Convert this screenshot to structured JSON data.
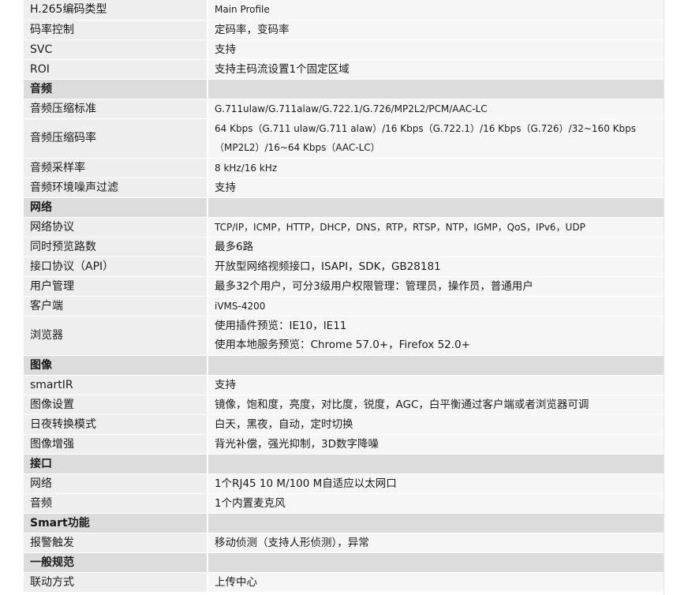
{
  "rows": [
    {
      "type": "row",
      "label": "H.265编码类型",
      "value": "Main Profile",
      "small": true
    },
    {
      "type": "row",
      "label": "码率控制",
      "value": "定码率，变码率"
    },
    {
      "type": "row",
      "label": "SVC",
      "value": "支持"
    },
    {
      "type": "row",
      "label": "ROI",
      "value": "支持主码流设置1个固定区域"
    },
    {
      "type": "section",
      "label": "音频"
    },
    {
      "type": "row",
      "label": "音频压缩标准",
      "value": "G.711ulaw/G.711alaw/G.722.1/G.726/MP2L2/PCM/AAC-LC",
      "small": true
    },
    {
      "type": "row",
      "label": "音频压缩码率",
      "lines": [
        "64 Kbps（G.711 ulaw/G.711 alaw）/16 Kbps（G.722.1）/16 Kbps（G.726）/32~160 Kbps",
        "（MP2L2）/16~64 Kbps（AAC-LC）"
      ],
      "small": true
    },
    {
      "type": "row",
      "label": "音频采样率",
      "value": "8 kHz/16 kHz",
      "small": true
    },
    {
      "type": "row",
      "label": "音频环境噪声过滤",
      "value": "支持"
    },
    {
      "type": "section",
      "label": "网络"
    },
    {
      "type": "row",
      "label": "网络协议",
      "value": "TCP/IP，ICMP，HTTP，DHCP，DNS，RTP，RTSP，NTP，IGMP，QoS，IPv6，UDP",
      "small": true
    },
    {
      "type": "row",
      "label": "同时预览路数",
      "value": "最多6路"
    },
    {
      "type": "row",
      "label": "接口协议（API）",
      "value": "开放型网络视频接口，ISAPI，SDK，GB28181"
    },
    {
      "type": "row",
      "label": "用户管理",
      "value": "最多32个用户，可分3级用户权限管理：管理员，操作员，普通用户"
    },
    {
      "type": "row",
      "label": "客户端",
      "value": "iVMS-4200",
      "small": true
    },
    {
      "type": "row",
      "label": "浏览器",
      "lines": [
        "使用插件预览：IE10，IE11",
        "使用本地服务预览：Chrome 57.0+，Firefox 52.0+"
      ]
    },
    {
      "type": "section",
      "label": "图像"
    },
    {
      "type": "row",
      "label": "smartIR",
      "value": "支持"
    },
    {
      "type": "row",
      "label": "图像设置",
      "value": "镜像，饱和度，亮度，对比度，锐度，AGC，白平衡通过客户端或者浏览器可调"
    },
    {
      "type": "row",
      "label": "日夜转换模式",
      "value": "白天，黑夜，自动，定时切换"
    },
    {
      "type": "row",
      "label": "图像增强",
      "value": "背光补偿，强光抑制，3D数字降噪"
    },
    {
      "type": "section",
      "label": "接口"
    },
    {
      "type": "row",
      "label": "网络",
      "value": "1个RJ45 10 M/100 M自适应以太网口"
    },
    {
      "type": "row",
      "label": "音频",
      "value": "1个内置麦克风"
    },
    {
      "type": "section",
      "label": "Smart功能"
    },
    {
      "type": "row",
      "label": "报警触发",
      "value": "移动侦测（支持人形侦测），异常"
    },
    {
      "type": "section",
      "label": "一般规范"
    },
    {
      "type": "row",
      "label": "联动方式",
      "value": "上传中心"
    }
  ]
}
